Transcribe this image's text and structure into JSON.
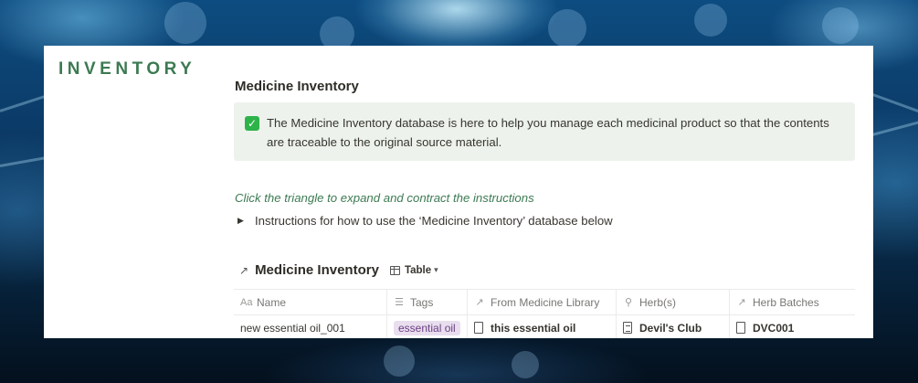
{
  "sidebar": {
    "title": "INVENTORY"
  },
  "page": {
    "title": "Medicine Inventory",
    "callout": {
      "icon": "check-mark-icon",
      "text": "The Medicine Inventory database is here to help you manage each medicinal product so that the contents are traceable to the original source material."
    },
    "hint": "Click the triangle to expand and contract the instructions",
    "toggle": {
      "icon": "triangle-right-icon",
      "label": "Instructions for how to use the ‘Medicine Inventory’ database below"
    }
  },
  "database": {
    "title": "Medicine Inventory",
    "link_icon": "arrow-up-right-icon",
    "view": {
      "icon": "table-icon",
      "label": "Table"
    },
    "columns": [
      {
        "icon": "text-icon",
        "glyph": "Aa",
        "label": "Name"
      },
      {
        "icon": "list-icon",
        "glyph": "☰",
        "label": "Tags"
      },
      {
        "icon": "relation-icon",
        "glyph": "↗",
        "label": "From Medicine Library"
      },
      {
        "icon": "search-icon",
        "glyph": "⚲",
        "label": "Herb(s)"
      },
      {
        "icon": "relation-icon",
        "glyph": "↗",
        "label": "Herb Batches"
      }
    ],
    "rows": [
      {
        "name": "new essential oil_001",
        "tag": "essential oil",
        "library": "this essential oil",
        "herb": "Devil's Club",
        "batch": "DVC001"
      }
    ]
  },
  "colors": {
    "accent_green": "#3c7a52",
    "callout_bg": "#edf3ec",
    "tag_bg": "#e8deee",
    "tag_text": "#6c3f84"
  }
}
